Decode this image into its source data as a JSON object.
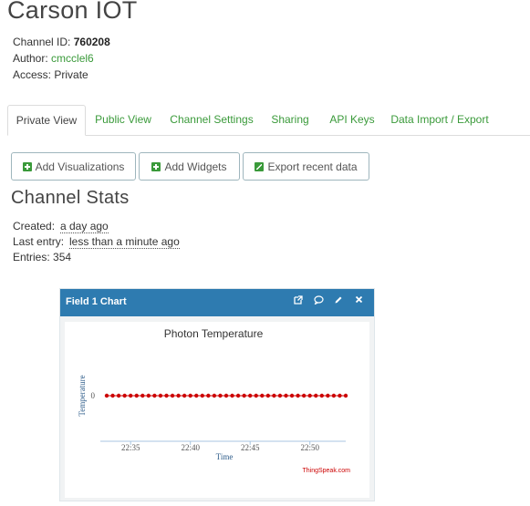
{
  "channel": {
    "title": "Carson IOT",
    "id_label": "Channel ID:",
    "id_value": "760208",
    "author_label": "Author:",
    "author_value": "cmcclel6",
    "access_label": "Access:",
    "access_value": "Private"
  },
  "tabs": [
    "Private View",
    "Public View",
    "Channel Settings",
    "Sharing",
    "API Keys",
    "Data Import / Export"
  ],
  "buttons": {
    "add_visualizations": "Add Visualizations",
    "add_widgets": "Add Widgets",
    "export_recent": "Export recent data"
  },
  "stats": {
    "heading": "Channel Stats",
    "created_label": "Created:",
    "created_value": "a day ago",
    "last_entry_label": "Last entry:",
    "last_entry_value": "less than a minute ago",
    "entries_label": "Entries:",
    "entries_value": "354"
  },
  "widget": {
    "title": "Field 1 Chart",
    "icons": [
      "external-link-icon",
      "comment-icon",
      "pencil-icon",
      "close-icon"
    ]
  },
  "colors": {
    "header_blue": "#2e7bb0",
    "link_green": "#3a9a3a",
    "series_red": "#cc0000"
  },
  "chart_data": {
    "type": "line",
    "title": "Photon Temperature",
    "xlabel": "Time",
    "ylabel": "Temperature",
    "credit": "ThingSpeak.com",
    "x_ticks": [
      "22:35",
      "22:40",
      "22:45",
      "22:50"
    ],
    "y_ticks": [
      "0"
    ],
    "x_range": [
      "22:33",
      "22:53"
    ],
    "series": [
      {
        "color": "#cc0000",
        "x": [
          "22:33",
          "22:33:30",
          "22:34",
          "22:34:30",
          "22:35",
          "22:35:30",
          "22:36",
          "22:36:30",
          "22:37",
          "22:37:30",
          "22:38",
          "22:38:30",
          "22:39",
          "22:39:30",
          "22:40",
          "22:40:30",
          "22:41",
          "22:41:30",
          "22:42",
          "22:42:30",
          "22:43",
          "22:43:30",
          "22:44",
          "22:44:30",
          "22:45",
          "22:45:30",
          "22:46",
          "22:46:30",
          "22:47",
          "22:47:30",
          "22:48",
          "22:48:30",
          "22:49",
          "22:49:30",
          "22:50",
          "22:50:30",
          "22:51",
          "22:51:30",
          "22:52",
          "22:52:30",
          "22:53"
        ],
        "y": [
          0,
          0,
          0,
          0,
          0,
          0,
          0,
          0,
          0,
          0,
          0,
          0,
          0,
          0,
          0,
          0,
          0,
          0,
          0,
          0,
          0,
          0,
          0,
          0,
          0,
          0,
          0,
          0,
          0,
          0,
          0,
          0,
          0,
          0,
          0,
          0,
          0,
          0,
          0,
          0,
          0
        ]
      }
    ],
    "grid": false
  }
}
